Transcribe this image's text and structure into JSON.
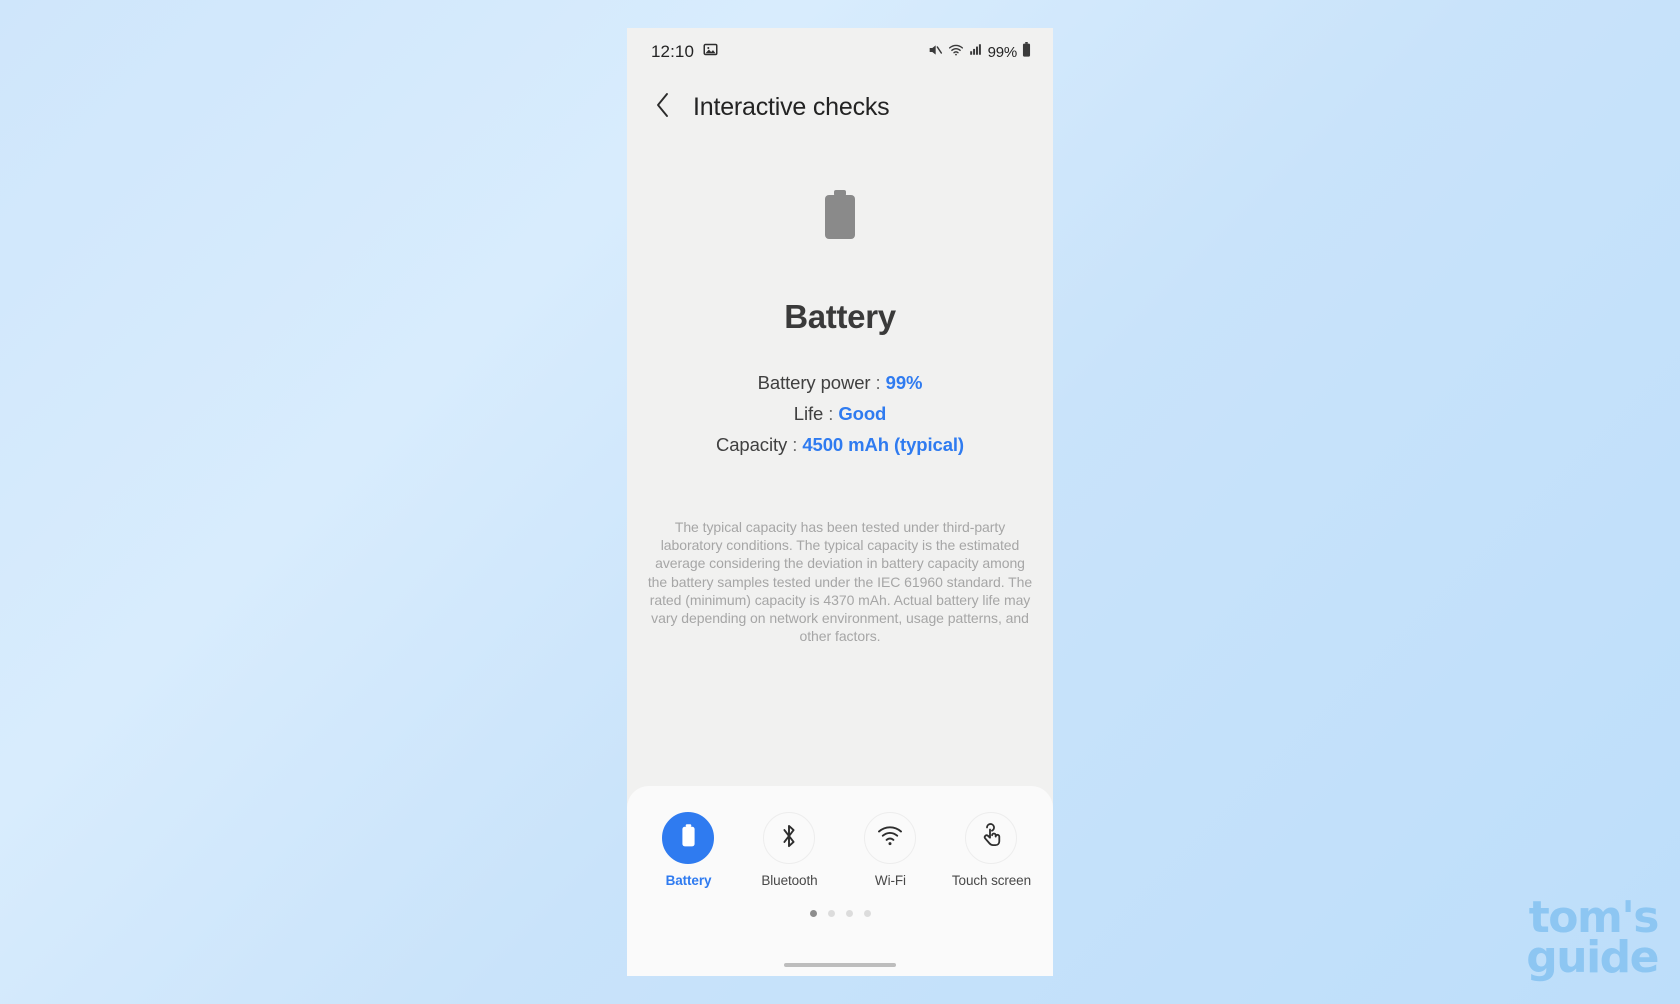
{
  "statusbar": {
    "time": "12:10",
    "battery_percent": "99%",
    "icons": [
      "gallery-icon",
      "mute-icon",
      "wifi-icon",
      "signal-icon",
      "battery-icon"
    ]
  },
  "header": {
    "title": "Interactive checks",
    "back_icon": "chevron-left-icon"
  },
  "main": {
    "hero_icon": "battery-icon",
    "device_title": "Battery",
    "stats": [
      {
        "label": "Battery power",
        "separator": ":",
        "value": "99%"
      },
      {
        "label": "Life",
        "separator": ":",
        "value": "Good"
      },
      {
        "label": "Capacity",
        "separator": ":",
        "value": "4500 mAh (typical)"
      }
    ],
    "disclaimer": "The typical capacity has been tested under third-party laboratory conditions. The typical capacity is the estimated average considering the deviation in battery capacity among the battery samples tested under the IEC 61960 standard. The rated (minimum) capacity is 4370 mAh. Actual battery life may vary depending on network environment, usage patterns, and other factors."
  },
  "bottom_sheet": {
    "tabs": [
      {
        "label": "Battery",
        "icon": "battery-icon",
        "active": true
      },
      {
        "label": "Bluetooth",
        "icon": "bluetooth-icon",
        "active": false
      },
      {
        "label": "Wi-Fi",
        "icon": "wifi-icon",
        "active": false
      },
      {
        "label": "Touch screen",
        "icon": "touch-screen-icon",
        "active": false
      }
    ],
    "page_dots": {
      "count": 4,
      "active_index": 0
    }
  },
  "watermark": {
    "line1": "tom's",
    "line2": "guide"
  },
  "colors": {
    "accent": "#2f7bf0",
    "screen_bg": "#f1f1f0",
    "sheet_bg": "#fafafa",
    "text_primary": "#3a3a3a",
    "text_muted": "#a6a6a6",
    "wallpaper": "#cfe6fb"
  }
}
